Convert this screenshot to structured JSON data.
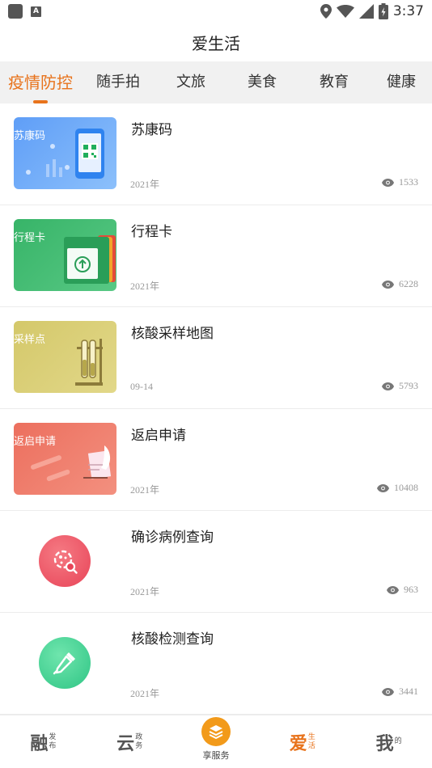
{
  "status_bar": {
    "time": "3:37",
    "notification_icons": [
      "gallery-icon",
      "a-icon"
    ],
    "system_icons": [
      "location-icon",
      "wifi-icon",
      "signal-icon",
      "battery-icon"
    ]
  },
  "header": {
    "title": "爱生活"
  },
  "tabs": [
    {
      "label": "疫情防控",
      "active": true
    },
    {
      "label": "随手拍",
      "active": false
    },
    {
      "label": "文旅",
      "active": false
    },
    {
      "label": "美食",
      "active": false
    },
    {
      "label": "教育",
      "active": false
    },
    {
      "label": "健康",
      "active": false
    }
  ],
  "items": [
    {
      "title": "苏康码",
      "thumb_label": "苏康码",
      "date": "2021年",
      "views": "1533",
      "thumb_color": "#5ea0f5",
      "icon": "qr-phone-icon"
    },
    {
      "title": "行程卡",
      "thumb_label": "行程卡",
      "date": "2021年",
      "views": "6228",
      "thumb_color": "#3fba6f",
      "icon": "trip-card-icon"
    },
    {
      "title": "核酸采样地图",
      "thumb_label": "采样点",
      "date": "09-14",
      "views": "5793",
      "thumb_color": "#d6cc6f",
      "icon": "test-tube-icon"
    },
    {
      "title": "返启申请",
      "thumb_label": "返启申请",
      "date": "2021年",
      "views": "10408",
      "thumb_color": "#ef7766",
      "icon": "application-icon"
    },
    {
      "title": "确诊病例查询",
      "date": "2021年",
      "views": "963",
      "thumb_color": "#ec4c5c",
      "icon": "virus-search-icon"
    },
    {
      "title": "核酸检测查询",
      "date": "2021年",
      "views": "3441",
      "thumb_color": "#3ed09a",
      "icon": "dropper-icon"
    }
  ],
  "bottom_nav": {
    "rong": {
      "big": "融",
      "small1": "发",
      "small2": "布"
    },
    "yun": {
      "big": "云",
      "small1": "政",
      "small2": "务"
    },
    "center": {
      "label": "享服务"
    },
    "ai": {
      "big": "爱",
      "small1": "生",
      "small2": "活",
      "active": true
    },
    "wo": {
      "big": "我",
      "small1": "的",
      "small2": ""
    }
  }
}
